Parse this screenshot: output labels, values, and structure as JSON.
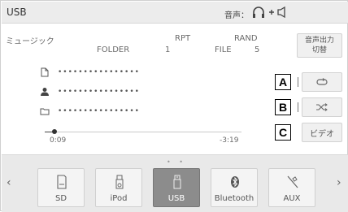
{
  "header": {
    "title": "USB",
    "audio_label": "音声："
  },
  "info": {
    "category": "ミュージック",
    "folder_label": "FOLDER",
    "folder_value": "1",
    "rpt_label": "RPT",
    "file_label": "FILE",
    "file_value": "5",
    "rand_label": "RAND"
  },
  "switch_button": {
    "line1": "音声出力",
    "line2": "切替"
  },
  "tracks": {
    "title_masked": "••••••••••••••••",
    "artist_masked": "••••••••••••••••",
    "album_masked": "••••••••••••••••"
  },
  "playback": {
    "elapsed": "0:09",
    "remaining": "-3:19",
    "progress_fraction": 0.05
  },
  "callouts": [
    "A",
    "B",
    "C"
  ],
  "side_buttons": {
    "video_label": "ビデオ"
  },
  "sources": [
    {
      "label": "SD",
      "icon": "sd-card-icon"
    },
    {
      "label": "iPod",
      "icon": "ipod-icon"
    },
    {
      "label": "USB",
      "icon": "usb-icon",
      "active": true
    },
    {
      "label": "Bluetooth",
      "icon": "bluetooth-icon"
    },
    {
      "label": "AUX",
      "icon": "aux-icon"
    }
  ],
  "colors": {
    "active_source": "#8c8c8c",
    "header_bg": "#ececec",
    "footer_bg": "#e9e9e9"
  }
}
